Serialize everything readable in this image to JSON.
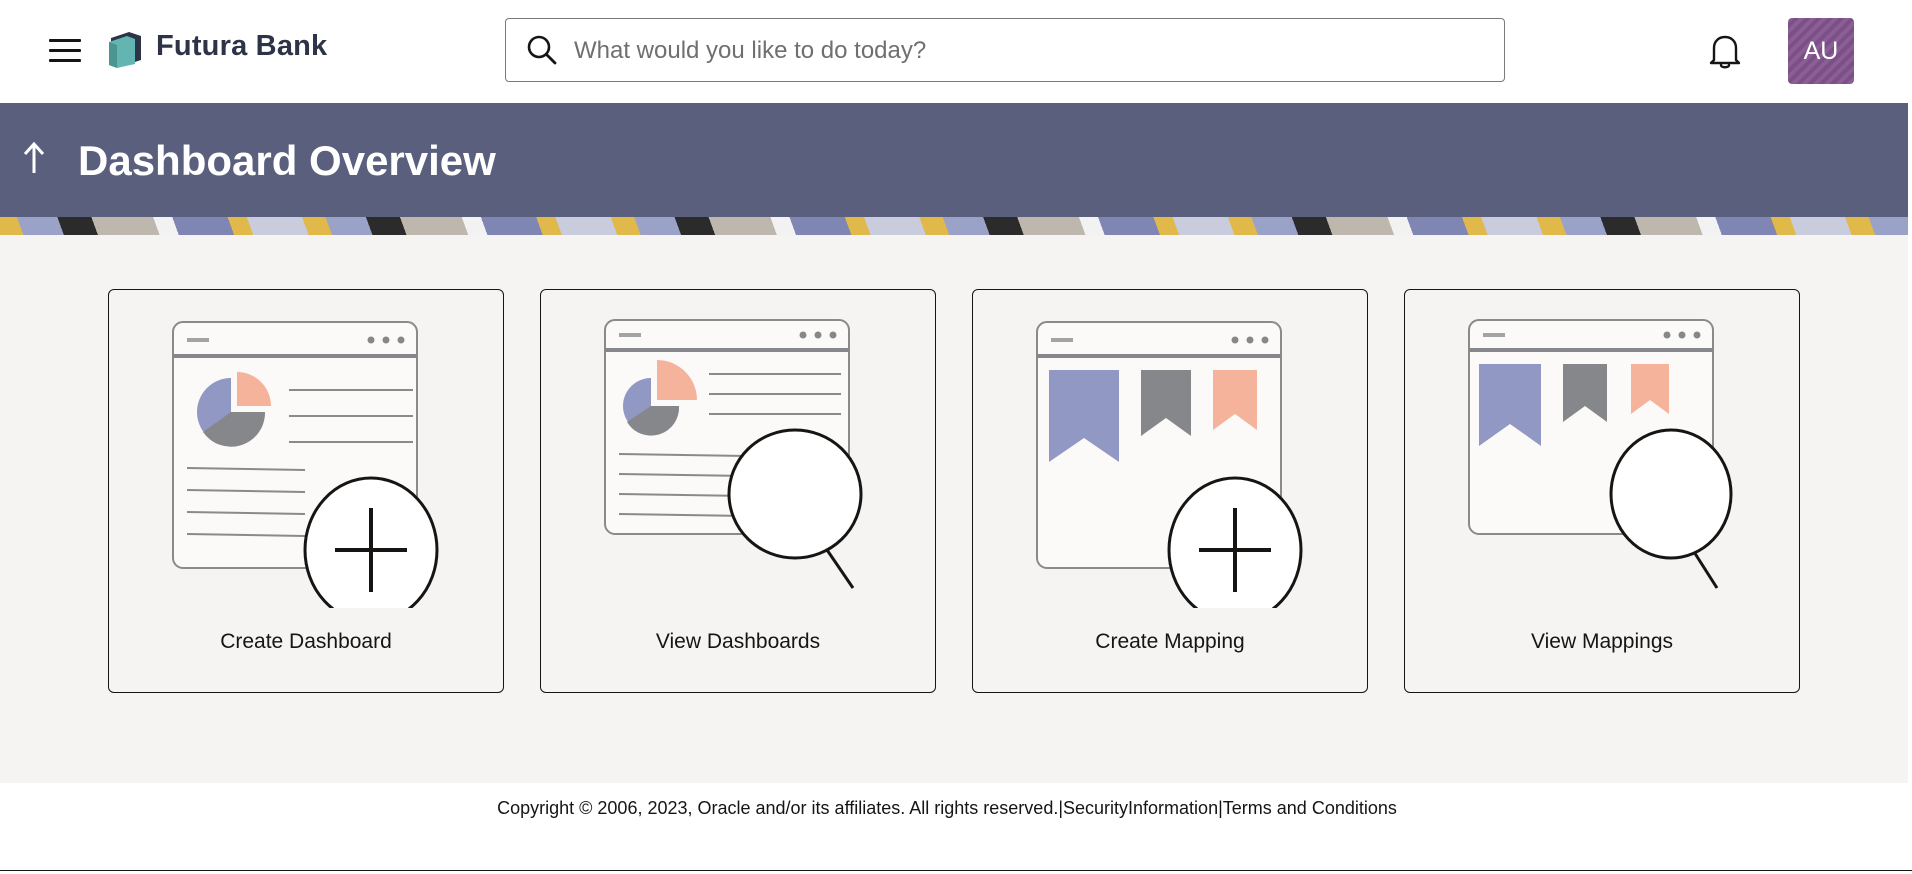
{
  "header": {
    "brand_name": "Futura Bank",
    "search": {
      "placeholder": "What would you like to do today?",
      "value": ""
    },
    "user_initials": "AU",
    "avatar_color": "#7a5087"
  },
  "banner": {
    "title": "Dashboard Overview",
    "background_color": "#5a5f7e"
  },
  "cards": [
    {
      "label": "Create Dashboard"
    },
    {
      "label": "View Dashboards"
    },
    {
      "label": "Create Mapping"
    },
    {
      "label": "View Mappings"
    }
  ],
  "footer": {
    "copyright": "Copyright © 2006, 2023, Oracle and/or its affiliates. All rights reserved.",
    "separator_1": "|",
    "security_link": "SecurityInformation",
    "separator_2": "|",
    "terms_link": "Terms and Conditions"
  },
  "icons": {
    "menu": "hamburger-icon",
    "logo": "futura-bank-logo",
    "search": "search-icon",
    "notifications": "bell-icon",
    "back": "up-arrow-icon"
  },
  "colors": {
    "accent_blue": "#9198c3",
    "accent_peach": "#f5b39c",
    "accent_gray": "#85878b"
  }
}
